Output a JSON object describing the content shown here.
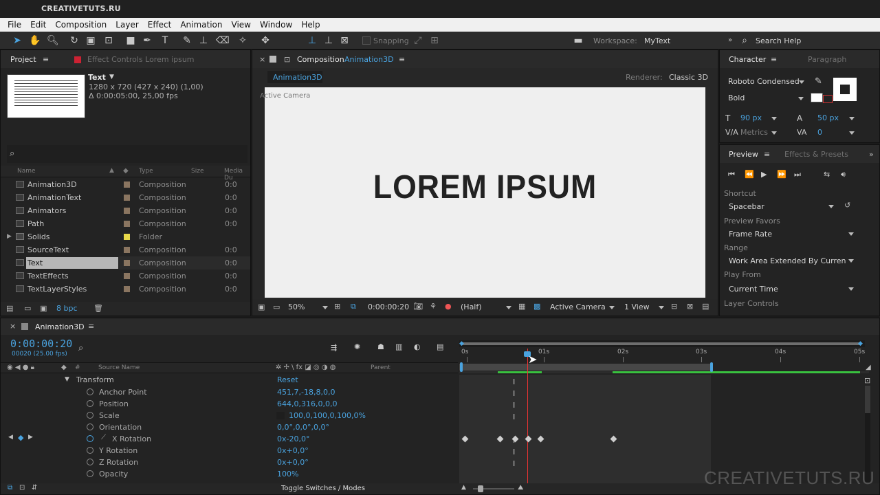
{
  "app": {
    "title_bar": "CREATIVETUTS.RU",
    "menu": [
      "File",
      "Edit",
      "Composition",
      "Layer",
      "Effect",
      "Animation",
      "View",
      "Window",
      "Help"
    ]
  },
  "toolbar": {
    "snapping_label": "Snapping",
    "workspace_label": "Workspace:",
    "workspace_value": "MyText",
    "search_help": "Search Help"
  },
  "project": {
    "tab_project": "Project",
    "tab_effect_controls": "Effect Controls Lorem ipsum",
    "selected_name": "Text",
    "selected_dims": "1280 x 720  (427 x 240) (1,00)",
    "selected_duration": "Δ 0:00:05:00, 25,00 fps",
    "col_name": "Name",
    "col_type": "Type",
    "col_size": "Size",
    "col_media": "Media Du",
    "items": [
      {
        "name": "Animation3D",
        "type": "Composition",
        "media": "0:0"
      },
      {
        "name": "AnimationText",
        "type": "Composition",
        "media": "0:0"
      },
      {
        "name": "Animators",
        "type": "Composition",
        "media": "0:0"
      },
      {
        "name": "Path",
        "type": "Composition",
        "media": "0:0"
      },
      {
        "name": "Solids",
        "type": "Folder",
        "media": ""
      },
      {
        "name": "SourceText",
        "type": "Composition",
        "media": "0:0"
      },
      {
        "name": "Text",
        "type": "Composition",
        "media": "0:0"
      },
      {
        "name": "TextEffects",
        "type": "Composition",
        "media": "0:0"
      },
      {
        "name": "TextLayerStyles",
        "type": "Composition",
        "media": "0:0"
      }
    ],
    "bpc": "8 bpc"
  },
  "composition": {
    "tab_label": "Composition",
    "tab_name": "Animation3D",
    "subtab": "Animation3D",
    "renderer_label": "Renderer:",
    "renderer_value": "Classic 3D",
    "view_label": "Active Camera",
    "canvas_text": "LOREM IPSUM",
    "zoom": "50%",
    "timecode": "0:00:00:20",
    "resolution": "(Half)",
    "camera": "Active Camera",
    "views": "1 View"
  },
  "character": {
    "tab_character": "Character",
    "tab_paragraph": "Paragraph",
    "font": "Roboto Condensed",
    "style": "Bold",
    "size": "90 px",
    "leading": "50 px",
    "kerning": "Metrics",
    "tracking": "0"
  },
  "preview": {
    "tab_preview": "Preview",
    "tab_effects": "Effects & Presets",
    "shortcut_label": "Shortcut",
    "shortcut_value": "Spacebar",
    "favors_label": "Preview Favors",
    "favors_value": "Frame Rate",
    "range_label": "Range",
    "range_value": "Work Area Extended By Current Ti",
    "playfrom_label": "Play From",
    "playfrom_value": "Current Time",
    "layer_controls": "Layer Controls"
  },
  "timeline": {
    "tab_name": "Animation3D",
    "timecode": "0:00:00:20",
    "frame_info": "00020 (25.00 fps)",
    "col_source": "Source Name",
    "col_parent": "Parent",
    "ruler": [
      "0s",
      "01s",
      "02s",
      "03s",
      "04s",
      "05s"
    ],
    "transform_label": "Transform",
    "reset_label": "Reset",
    "properties": [
      {
        "label": "Anchor Point",
        "value": "451,7,-18,8,0,0"
      },
      {
        "label": "Position",
        "value": "644,0,316,0,0,0"
      },
      {
        "label": "Scale",
        "value": "100,0,100,0,100,0%"
      },
      {
        "label": "Orientation",
        "value": "0,0°,0,0°,0,0°"
      },
      {
        "label": "X Rotation",
        "value": "0x-20,0°"
      },
      {
        "label": "Y Rotation",
        "value": "0x+0,0°"
      },
      {
        "label": "Z Rotation",
        "value": "0x+0,0°"
      },
      {
        "label": "Opacity",
        "value": "100%"
      }
    ],
    "toggle_label": "Toggle Switches / Modes",
    "watermark": "CREATIVETUTS.RU"
  }
}
